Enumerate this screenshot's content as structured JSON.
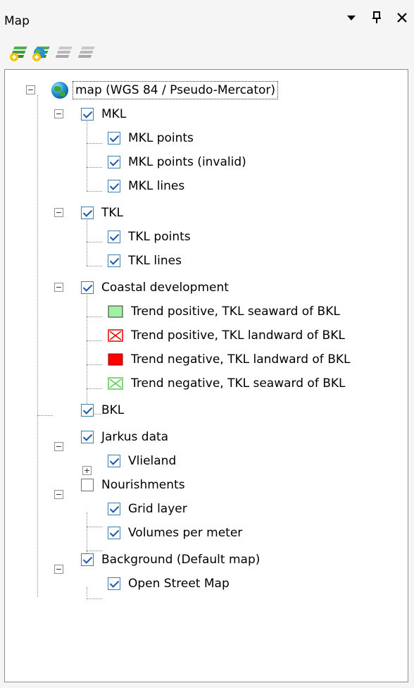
{
  "window": {
    "title": "Map"
  },
  "tree": {
    "root": "map (WGS 84 / Pseudo-Mercator)",
    "mkl": "MKL",
    "mkl_points": "MKL points",
    "mkl_points_invalid": "MKL points (invalid)",
    "mkl_lines": "MKL lines",
    "tkl": "TKL",
    "tkl_points": "TKL points",
    "tkl_lines": "TKL lines",
    "coastal": "Coastal development",
    "trend1": "Trend positive, TKL seaward of BKL",
    "trend2": "Trend positive, TKL landward of BKL",
    "trend3": "Trend negative, TKL landward of BKL",
    "trend4": "Trend negative, TKL seaward of BKL",
    "bkl": "BKL",
    "jarkus": "Jarkus data",
    "vlieland": "Vlieland",
    "nourishments": "Nourishments",
    "grid": "Grid layer",
    "volumes": "Volumes per meter",
    "background": "Background (Default map)",
    "osm": "Open Street Map"
  },
  "icons": {
    "dropdown": "chevron-down-icon",
    "pin": "pin-icon",
    "close": "close-icon",
    "add_layer": "add-layer-icon",
    "add_wms": "add-wms-layer-icon",
    "layer_up": "layer-up-icon",
    "layer_down": "layer-down-icon",
    "globe": "globe-icon"
  },
  "colors": {
    "selection_border": "#333333",
    "checkbox_check": "#1e57a8",
    "legend_green": "#a3f0a3",
    "legend_red": "#ff0000"
  }
}
